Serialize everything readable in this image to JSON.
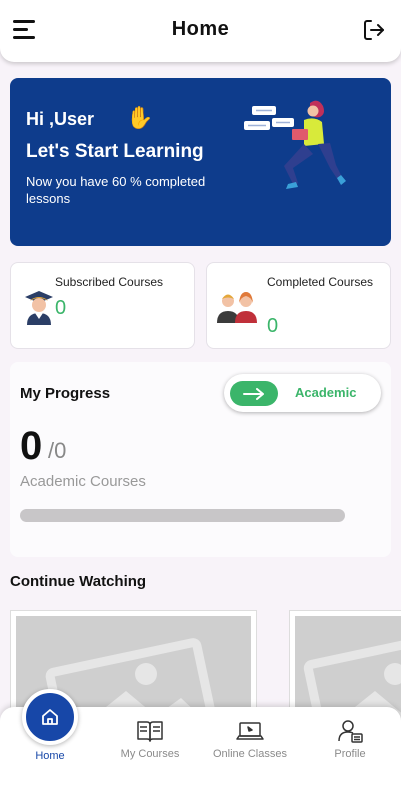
{
  "header": {
    "title": "Home",
    "menu_icon": "hamburger-menu-icon",
    "logout_icon": "logout-icon"
  },
  "hero": {
    "greeting": "Hi ,User",
    "wave_icon": "✋",
    "headline": "Let's Start Learning",
    "subtitle": "Now you have 60 % completed lessons",
    "background": "#0e3c8c",
    "illustration": "student-reading-illustration"
  },
  "stats": {
    "subscribed": {
      "label": "Subscribed Courses",
      "value": "0",
      "icon": "graduate-icon"
    },
    "completed": {
      "label": "Completed Courses",
      "value": "0",
      "icon": "team-icon"
    },
    "value_color": "#3bb56a"
  },
  "progress": {
    "title": "My Progress",
    "toggle_label": "Academic",
    "completed": "0",
    "total": "/0",
    "caption": "Academic Courses",
    "fraction": 0
  },
  "continue_watching": {
    "title": "Continue Watching",
    "cards": [
      {
        "thumb_icon": "image-placeholder-icon"
      },
      {
        "thumb_icon": "image-placeholder-icon"
      }
    ]
  },
  "bottom_nav": {
    "items": [
      {
        "label": "Home",
        "icon": "home-icon",
        "active": true
      },
      {
        "label": "My Courses",
        "icon": "book-icon",
        "active": false
      },
      {
        "label": "Online Classes",
        "icon": "laptop-icon",
        "active": false
      },
      {
        "label": "Profile",
        "icon": "profile-icon",
        "active": false
      }
    ],
    "active_color": "#1747a8"
  }
}
